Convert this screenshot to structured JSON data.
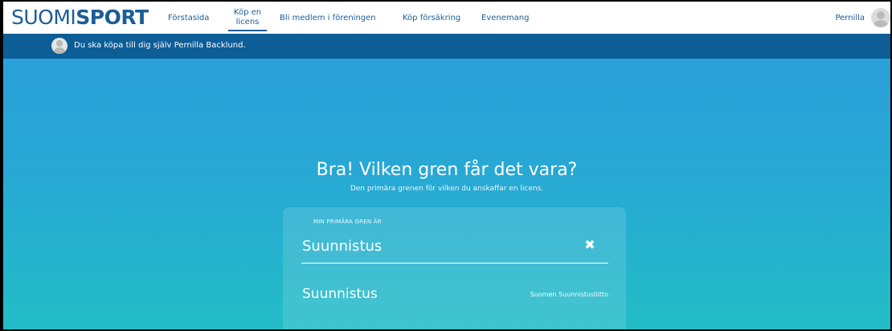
{
  "header": {
    "logo_thin": "SUOMI",
    "logo_bold": "SPORT",
    "nav": [
      {
        "label": "Förstasida"
      },
      {
        "label_line1": "Köp en",
        "label_line2": "licens"
      },
      {
        "label": "Bli medlem i föreningen"
      },
      {
        "label": "Köp försäkring"
      },
      {
        "label": "Evenemang"
      }
    ],
    "user_name": "Pernilla"
  },
  "infobar": {
    "text": "Du ska köpa till dig själv Pernilla Backlund."
  },
  "hero": {
    "title": "Bra! Vilken gren får det vara?",
    "subtitle": "Den primära grenen för vilken du anskaffar en licens."
  },
  "form": {
    "field_label": "MIN PRIMÄRA GREN ÄR",
    "field_value": "Suunnistus",
    "clear_icon": "close-icon"
  },
  "results": [
    {
      "name": "Suunnistus",
      "org": "Suomen Suunnistusliitto"
    }
  ],
  "colors": {
    "brand": "#1b5d96",
    "infobar": "#0d5d96",
    "hero_top": "#2a9fd8",
    "hero_bottom": "#23bdc6"
  }
}
